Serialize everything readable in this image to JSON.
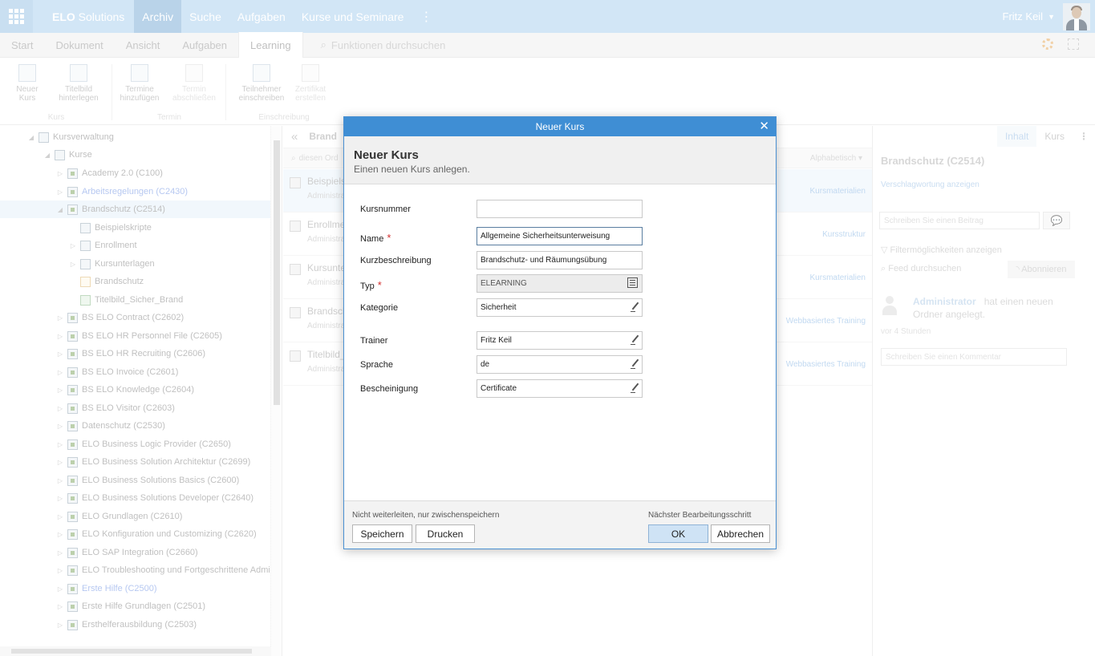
{
  "topbar": {
    "brand_strong": "ELO",
    "brand_rest": " Solutions",
    "nav": [
      "Archiv",
      "Suche",
      "Aufgaben",
      "Kurse und Seminare"
    ],
    "active_nav": "Archiv",
    "user": "Fritz Keil"
  },
  "ribbon_tabs": {
    "tabs": [
      "Start",
      "Dokument",
      "Ansicht",
      "Aufgaben",
      "Learning"
    ],
    "active": "Learning",
    "search_placeholder": "Funktionen durchsuchen"
  },
  "ribbon": {
    "groups": [
      {
        "title": "Kurs",
        "buttons": [
          {
            "l1": "Neuer",
            "l2": "Kurs"
          },
          {
            "l1": "Titelbild",
            "l2": "hinterlegen"
          }
        ]
      },
      {
        "title": "Termin",
        "buttons": [
          {
            "l1": "Termine",
            "l2": "hinzufügen"
          },
          {
            "l1": "Termin",
            "l2": "abschließen"
          }
        ]
      },
      {
        "title": "Einschreibung",
        "buttons": [
          {
            "l1": "Teilnehmer",
            "l2": "einschreiben"
          },
          {
            "l1": "Zertifikat",
            "l2": "erstellen"
          }
        ]
      }
    ]
  },
  "tree": {
    "items": [
      {
        "label": "Kursverwaltung"
      },
      {
        "label": "Kurse"
      },
      {
        "label": "Academy 2.0 (C100)"
      },
      {
        "label": "Arbeitsregelungen (C2430)"
      },
      {
        "label": "Brandschutz (C2514)"
      },
      {
        "label": "Beispielskripte"
      },
      {
        "label": "Enrollment"
      },
      {
        "label": "Kursunterlagen"
      },
      {
        "label": "Brandschutz"
      },
      {
        "label": "Titelbild_Sicher_Brand"
      },
      {
        "label": "BS ELO Contract (C2602)"
      },
      {
        "label": "BS ELO HR Personnel File (C2605)"
      },
      {
        "label": "BS ELO HR Recruiting (C2606)"
      },
      {
        "label": "BS ELO Invoice (C2601)"
      },
      {
        "label": "BS ELO Knowledge (C2604)"
      },
      {
        "label": "BS ELO Visitor (C2603)"
      },
      {
        "label": "Datenschutz (C2530)"
      },
      {
        "label": "ELO Business Logic Provider (C2650)"
      },
      {
        "label": "ELO Business Solution Architektur (C2699)"
      },
      {
        "label": "ELO Business Solutions Basics (C2600)"
      },
      {
        "label": "ELO Business Solutions Developer (C2640)"
      },
      {
        "label": "ELO Grundlagen (C2610)"
      },
      {
        "label": "ELO Konfiguration und Customizing (C2620)"
      },
      {
        "label": "ELO SAP Integration (C2660)"
      },
      {
        "label": "ELO Troubleshooting und Fortgeschrittene Administra"
      },
      {
        "label": "Erste Hilfe (C2500)"
      },
      {
        "label": "Erste Hilfe Grundlagen (C2501)"
      },
      {
        "label": "Ersthelferausbildung (C2503)"
      }
    ]
  },
  "middle": {
    "breadcrumb": "Brand",
    "search_placeholder": "diesen Ord",
    "sort_label": "Alphabetisch",
    "items": [
      {
        "title": "Beispiels",
        "sub": "Administra",
        "right": "Kursmaterialien"
      },
      {
        "title": "Enrollmer",
        "sub": "Administra",
        "right": "Kursstruktur"
      },
      {
        "title": "Kursunter",
        "sub": "Administra",
        "right": "Kursmaterialien"
      },
      {
        "title": "Brandsch",
        "sub": "Administra",
        "right": "Webbasiertes Training"
      },
      {
        "title": "Titelbild_",
        "sub": "Administra",
        "right": "Webbasiertes Training"
      }
    ]
  },
  "right_panel": {
    "tabs": [
      "Inhalt",
      "Kurs"
    ],
    "title": "Brandschutz (C2514)",
    "tagging_link": "Verschlagwortung anzeigen",
    "post_placeholder": "Schreiben Sie einen Beitrag",
    "filter_link": "Filtermöglichkeiten anzeigen",
    "feed_search": "Feed durchsuchen",
    "subscribe": "Abonnieren",
    "feed_author": "Administrator",
    "feed_text1": "hat einen neuen",
    "feed_text2": "Ordner angelegt.",
    "feed_time": "vor 4 Stunden",
    "comment_placeholder": "Schreiben Sie einen Kommentar"
  },
  "dialog": {
    "window_title": "Neuer Kurs",
    "heading": "Neuer Kurs",
    "subheading": "Einen neuen Kurs anlegen.",
    "fields": {
      "kursnummer": {
        "label": "Kursnummer",
        "value": ""
      },
      "name": {
        "label": "Name",
        "value": "Allgemeine Sicherheitsunterweisung"
      },
      "kurzbeschreibung": {
        "label": "Kurzbeschreibung",
        "value": "Brandschutz- und Räumungsübung"
      },
      "typ": {
        "label": "Typ",
        "value": "ELEARNING"
      },
      "kategorie": {
        "label": "Kategorie",
        "value": "Sicherheit"
      },
      "trainer": {
        "label": "Trainer",
        "value": "Fritz Keil"
      },
      "sprache": {
        "label": "Sprache",
        "value": "de"
      },
      "bescheinigung": {
        "label": "Bescheinigung",
        "value": "Certificate"
      }
    },
    "required_mark": "*",
    "footer_left_label": "Nicht weiterleiten, nur zwischenspeichern",
    "footer_right_label": "Nächster Bearbeitungsschritt",
    "buttons": {
      "save": "Speichern",
      "print": "Drucken",
      "ok": "OK",
      "cancel": "Abbrechen"
    }
  }
}
